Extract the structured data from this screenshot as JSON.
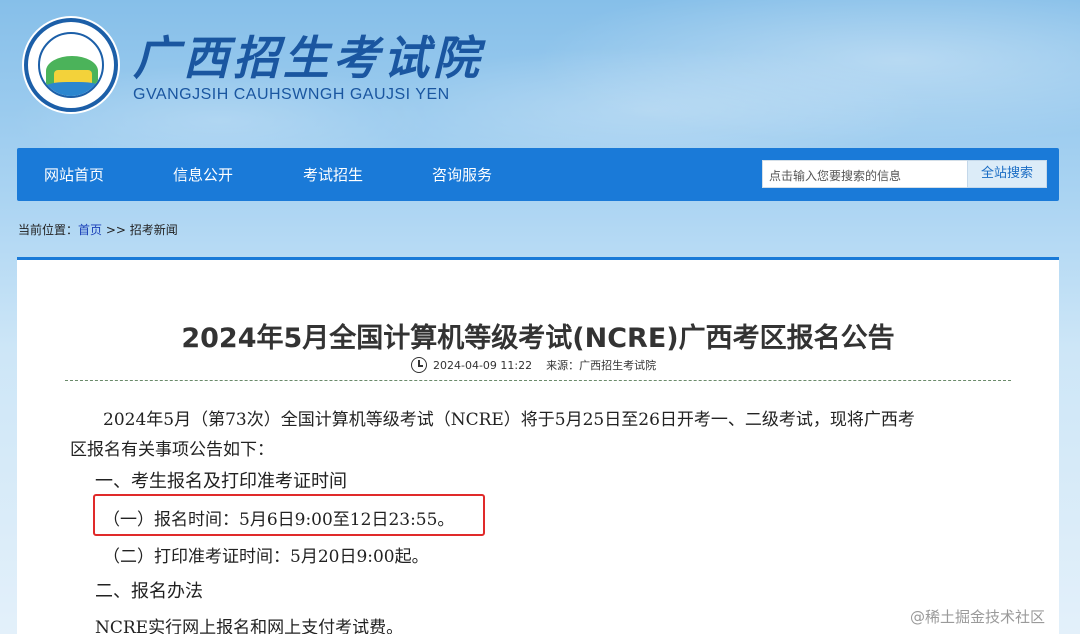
{
  "header": {
    "title": "广西招生考试院",
    "subtitle": "GVANGJSIH CAUHSWNGH GAUJSI YEN"
  },
  "nav": {
    "items": [
      "网站首页",
      "信息公开",
      "考试招生",
      "咨询服务"
    ],
    "search_placeholder": "点击输入您要搜索的信息",
    "search_button": "全站搜索"
  },
  "breadcrumb": {
    "prefix": "当前位置：",
    "home": "首页",
    "sep": " >> ",
    "current": "招考新闻"
  },
  "article": {
    "title": "2024年5月全国计算机等级考试(NCRE)广西考区报名公告",
    "date": "2024-04-09 11:22",
    "source": "来源：广西招生考试院",
    "intro_line1": "2024年5月（第73次）全国计算机等级考试（NCRE）将于5月25日至26日开考一、二级考试，现将广西考",
    "intro_line2": "区报名有关事项公告如下：",
    "section1": "一、考生报名及打印准考证时间",
    "item1": "（一）报名时间：5月6日9:00至12日23:55。",
    "item2": "（二）打印准考证时间：5月20日9:00起。",
    "section2": "二、报名办法",
    "item3": "NCRE实行网上报名和网上支付考试费。"
  },
  "watermark": "@稀土掘金技术社区",
  "colors": {
    "nav_bg": "#1a7ad8",
    "brand": "#1a56a0",
    "highlight": "#e02a2a"
  }
}
